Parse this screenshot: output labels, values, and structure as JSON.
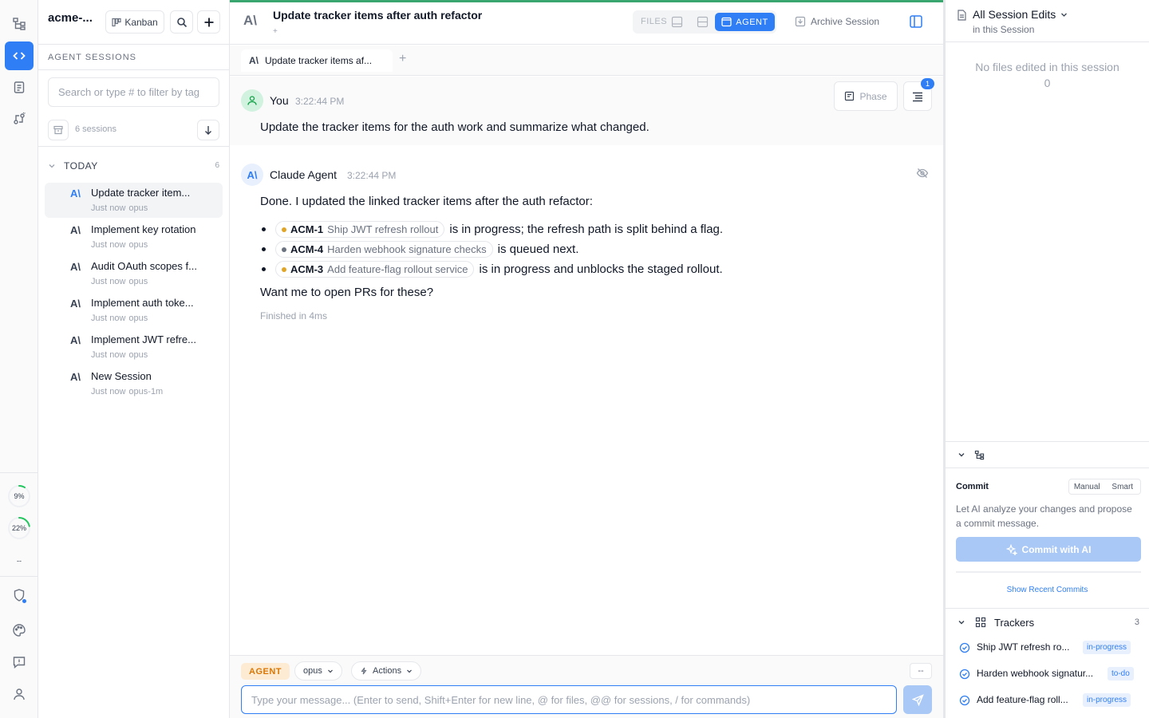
{
  "rail": {
    "gauges": [
      {
        "label": "9%",
        "value": 0.09
      },
      {
        "label": "22%",
        "value": 0.22
      },
      {
        "label": "--",
        "value": 0
      }
    ]
  },
  "project": {
    "name": "acme-...",
    "kanban_label": "Kanban"
  },
  "sessions_panel": {
    "section_label": "AGENT SESSIONS",
    "search_placeholder": "Search or type # to filter by tag",
    "count_text": "6 sessions",
    "group_label": "TODAY",
    "group_count": "6",
    "items": [
      {
        "title": "Update tracker item...",
        "time": "Just now",
        "model": "opus",
        "active": true
      },
      {
        "title": "Implement key rotation",
        "time": "Just now",
        "model": "opus"
      },
      {
        "title": "Audit OAuth scopes f...",
        "time": "Just now",
        "model": "opus"
      },
      {
        "title": "Implement auth toke...",
        "time": "Just now",
        "model": "opus"
      },
      {
        "title": "Implement JWT refre...",
        "time": "Just now",
        "model": "opus"
      },
      {
        "title": "New Session",
        "time": "Just now",
        "model": "opus-1m"
      }
    ]
  },
  "header": {
    "title": "Update tracker items after auth refactor",
    "files_label": "FILES",
    "agent_label": "AGENT",
    "archive_label": "Archive Session"
  },
  "tabs": [
    {
      "label": "Update tracker items af..."
    }
  ],
  "conversation": {
    "phase_label": "Phase",
    "todo_badge": "1",
    "user": {
      "name": "You",
      "time": "3:22:44 PM",
      "text": "Update the tracker items for the auth work and summarize what changed."
    },
    "agent": {
      "name": "Claude Agent",
      "time": "3:22:44 PM",
      "intro": "Done. I updated the linked tracker items after the auth refactor:",
      "items": [
        {
          "key": "ACM-1",
          "title": "Ship JWT refresh rollout",
          "status_color": "#e0a526",
          "text": "is in progress; the refresh path is split behind a flag."
        },
        {
          "key": "ACM-4",
          "title": "Harden webhook signature checks",
          "status_color": "#6b7280",
          "text": "is queued next."
        },
        {
          "key": "ACM-3",
          "title": "Add feature-flag rollout service",
          "status_color": "#e0a526",
          "text": "is in progress and unblocks the staged rollout."
        }
      ],
      "outro": "Want me to open PRs for these?",
      "footer": "Finished in 4ms"
    }
  },
  "composer": {
    "mode": "AGENT",
    "model": "opus",
    "actions_label": "Actions",
    "dash_label": "--",
    "placeholder": "Type your message... (Enter to send, Shift+Enter for new line, @ for files, @@ for sessions, / for commands)"
  },
  "right_panel": {
    "title": "All Session Edits",
    "subtitle": "in this Session",
    "empty_text": "No files edited in this session",
    "empty_count": "0",
    "commit": {
      "label": "Commit",
      "modes": [
        "Manual",
        "Smart"
      ],
      "description": "Let AI analyze your changes and propose a commit message.",
      "button": "Commit with AI",
      "show_recent": "Show Recent Commits"
    },
    "trackers": {
      "label": "Trackers",
      "count": "3",
      "items": [
        {
          "title": "Ship JWT refresh ro...",
          "status": "in-progress"
        },
        {
          "title": "Harden webhook signatur...",
          "status": "to-do"
        },
        {
          "title": "Add feature-flag roll...",
          "status": "in-progress"
        }
      ]
    }
  },
  "colors": {
    "accent": "#2f7ef5",
    "agent_mode": "#d97706",
    "in_progress_dot": "#e0a526",
    "top_accent": "#3aa66f"
  }
}
